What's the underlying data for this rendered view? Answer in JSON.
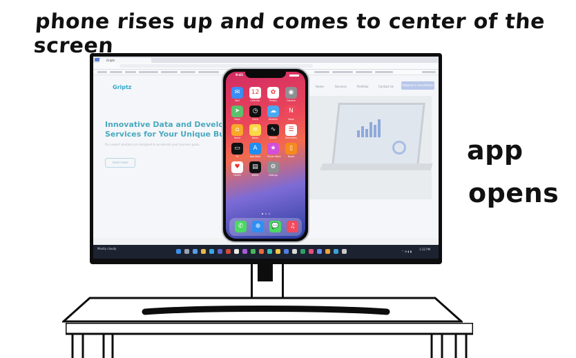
{
  "caption": {
    "headline": "phone rises up and comes to center of the screen",
    "side_line1": "app",
    "side_line2": "opens"
  },
  "browser": {
    "tab_title": "Griptz",
    "url_text": ""
  },
  "website": {
    "logo": "Griptz",
    "nav": [
      "Home",
      "Services",
      "Portfolio",
      "Contact Us"
    ],
    "nav_button": "Request a consultation",
    "hero_line1": "Innovative Data and Developm",
    "hero_line2": "Services for Your Unique Busin",
    "hero_sub": "Our expert solutions are designed to accelerate your business goals.",
    "hero_button": "Learn more"
  },
  "phone": {
    "time": "9:41",
    "apps": [
      {
        "label": "Mail",
        "color": "#3b8ef5",
        "glyph": "✉"
      },
      {
        "label": "Calendar",
        "color": "#ffffff",
        "glyph": "12"
      },
      {
        "label": "Photos",
        "color": "#ffffff",
        "glyph": "✿"
      },
      {
        "label": "Camera",
        "color": "#8e8e93",
        "glyph": "◉"
      },
      {
        "label": "Maps",
        "color": "#5cc06c",
        "glyph": "➤"
      },
      {
        "label": "Clock",
        "color": "#111111",
        "glyph": "◷"
      },
      {
        "label": "Weather",
        "color": "#4aa8f0",
        "glyph": "☁"
      },
      {
        "label": "News",
        "color": "#f0485a",
        "glyph": "N"
      },
      {
        "label": "Home",
        "color": "#f7a92a",
        "glyph": "⌂"
      },
      {
        "label": "Notes",
        "color": "#fbd948",
        "glyph": "≡"
      },
      {
        "label": "Stocks",
        "color": "#111111",
        "glyph": "∿"
      },
      {
        "label": "Reminders",
        "color": "#ffffff",
        "glyph": "☰"
      },
      {
        "label": "TV",
        "color": "#111111",
        "glyph": "▭"
      },
      {
        "label": "App Store",
        "color": "#1e8ef2",
        "glyph": "A"
      },
      {
        "label": "iTunes Store",
        "color": "#d24fd8",
        "glyph": "★"
      },
      {
        "label": "Books",
        "color": "#f58a1f",
        "glyph": "▯"
      },
      {
        "label": "Health",
        "color": "#ffffff",
        "glyph": "♥"
      },
      {
        "label": "Wallet",
        "color": "#111111",
        "glyph": "▤"
      },
      {
        "label": "Settings",
        "color": "#8e8e93",
        "glyph": "⚙"
      }
    ],
    "dock": [
      {
        "name": "Phone",
        "color": "#4bd864",
        "glyph": "✆"
      },
      {
        "name": "Safari",
        "color": "#2f8ff2",
        "glyph": "⊕"
      },
      {
        "name": "Messages",
        "color": "#4bd864",
        "glyph": "💬"
      },
      {
        "name": "Music",
        "color": "#f24a5f",
        "glyph": "♫"
      }
    ]
  },
  "taskbar": {
    "left_text": "Mostly cloudy",
    "clock": "1:32 PM"
  },
  "colors": {
    "accent": "#4aa9bf",
    "taskbar": "#1c2230"
  }
}
